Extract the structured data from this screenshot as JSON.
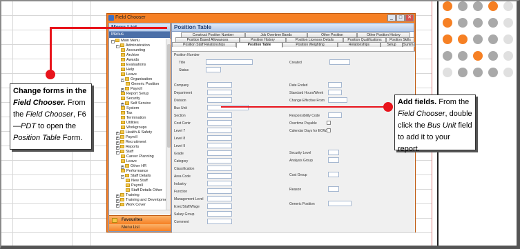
{
  "colors": {
    "accent": "#f68024",
    "callout_line": "#e8141c",
    "dot_orange": "#f68024",
    "dot_grey": "#a9a9a9"
  },
  "window": {
    "title": "Field Chooser",
    "buttons": [
      "_",
      "□",
      "✕"
    ]
  },
  "sidebar": {
    "header": "Menu List",
    "menus_label": "Menus",
    "items": [
      {
        "label": "Main Menu",
        "level": 0,
        "exp": "-"
      },
      {
        "label": "Administration",
        "level": 1,
        "exp": "-"
      },
      {
        "label": "Accounting",
        "level": 2
      },
      {
        "label": "Archive",
        "level": 2
      },
      {
        "label": "Awards",
        "level": 2
      },
      {
        "label": "Evaluations",
        "level": 2
      },
      {
        "label": "Help",
        "level": 2
      },
      {
        "label": "Leave",
        "level": 2
      },
      {
        "label": "Organisation",
        "level": 2,
        "exp": "-"
      },
      {
        "label": "Generic Position",
        "level": 3
      },
      {
        "label": "Payroll",
        "level": 2,
        "exp": "+"
      },
      {
        "label": "Report Setup",
        "level": 2
      },
      {
        "label": "Security",
        "level": 2
      },
      {
        "label": "Self Service",
        "level": 2,
        "exp": "+"
      },
      {
        "label": "System",
        "level": 2
      },
      {
        "label": "Tax",
        "level": 2
      },
      {
        "label": "Termination",
        "level": 2
      },
      {
        "label": "Utilities",
        "level": 2
      },
      {
        "label": "Workgroups",
        "level": 2
      },
      {
        "label": "Health & Safety",
        "level": 1,
        "exp": "+"
      },
      {
        "label": "Payroll",
        "level": 1,
        "exp": "+"
      },
      {
        "label": "Recruitment",
        "level": 1,
        "exp": "+"
      },
      {
        "label": "Reports",
        "level": 1,
        "exp": "+"
      },
      {
        "label": "Staff",
        "level": 1,
        "exp": "-"
      },
      {
        "label": "Career Planning",
        "level": 2
      },
      {
        "label": "Leave",
        "level": 2
      },
      {
        "label": "Other HR",
        "level": 2,
        "exp": "+"
      },
      {
        "label": "Performance",
        "level": 2
      },
      {
        "label": "Staff Details",
        "level": 2,
        "exp": "-"
      },
      {
        "label": "New Staff",
        "level": 3
      },
      {
        "label": "Payroll",
        "level": 3
      },
      {
        "label": "Staff Details Other",
        "level": 3
      },
      {
        "label": "Training",
        "level": 1,
        "exp": "+"
      },
      {
        "label": "Training and Development",
        "level": 1,
        "exp": "+"
      },
      {
        "label": "Work Cover",
        "level": 1,
        "exp": "+"
      }
    ],
    "favourites": "Favourites",
    "menu_list_btn": "Menu List"
  },
  "main": {
    "header": "Position Table",
    "tab_rows": [
      [
        "Construct Position Number",
        "Job Overtime Bands",
        "Other Position",
        "Other Position History"
      ],
      [
        "Position Based Allowances",
        "Position History",
        "Position Licences Details",
        "Position Qualifications",
        "Position Skills"
      ],
      [
        "Position Staff Relationships",
        "Position Table",
        "Position Weighting",
        "Relationships",
        "Setup",
        "Summary"
      ]
    ],
    "active_tab": "Position Table",
    "fields_top": [
      "Position Number",
      "Title",
      "Status"
    ],
    "created_label": "Created",
    "fields_left": [
      "Company",
      "Department",
      "Division",
      "Bus Unit",
      "Section",
      "Cost Centr",
      "Level 7",
      "Level 8",
      "Level 9",
      "Grade",
      "Category",
      "Classification",
      "Area Code",
      "Industry",
      "Function",
      "Management Level",
      "Exec/Staff/Wage",
      "Salary Group",
      "Comment"
    ],
    "fields_right": [
      "Date Ended",
      "Standard Hours/Week",
      "Change Effective From",
      "",
      "Responsibility Code",
      "Overtime Payable",
      "Calendar Days for EOWA"
    ],
    "fields_right_lower": [
      "Security Level",
      "Analysis Group",
      "Cost Group",
      "Reason",
      "Generic Position"
    ]
  },
  "callouts": {
    "left": {
      "bold": "Change forms in the ",
      "bold_italic": "Field Chooser.",
      "r1": " From the ",
      "i1": "Field Chooser",
      "r2": ", F6—",
      "i2": "PDT",
      "r3": " to open the ",
      "i3": "Position Table",
      "r4": " Form."
    },
    "right": {
      "bold": "Add fields.",
      "r1": " From the ",
      "i1": "Field Chooser",
      "r2": ", double click the ",
      "i2": "Bus Unit",
      "r3": " field to add it to your report."
    }
  }
}
